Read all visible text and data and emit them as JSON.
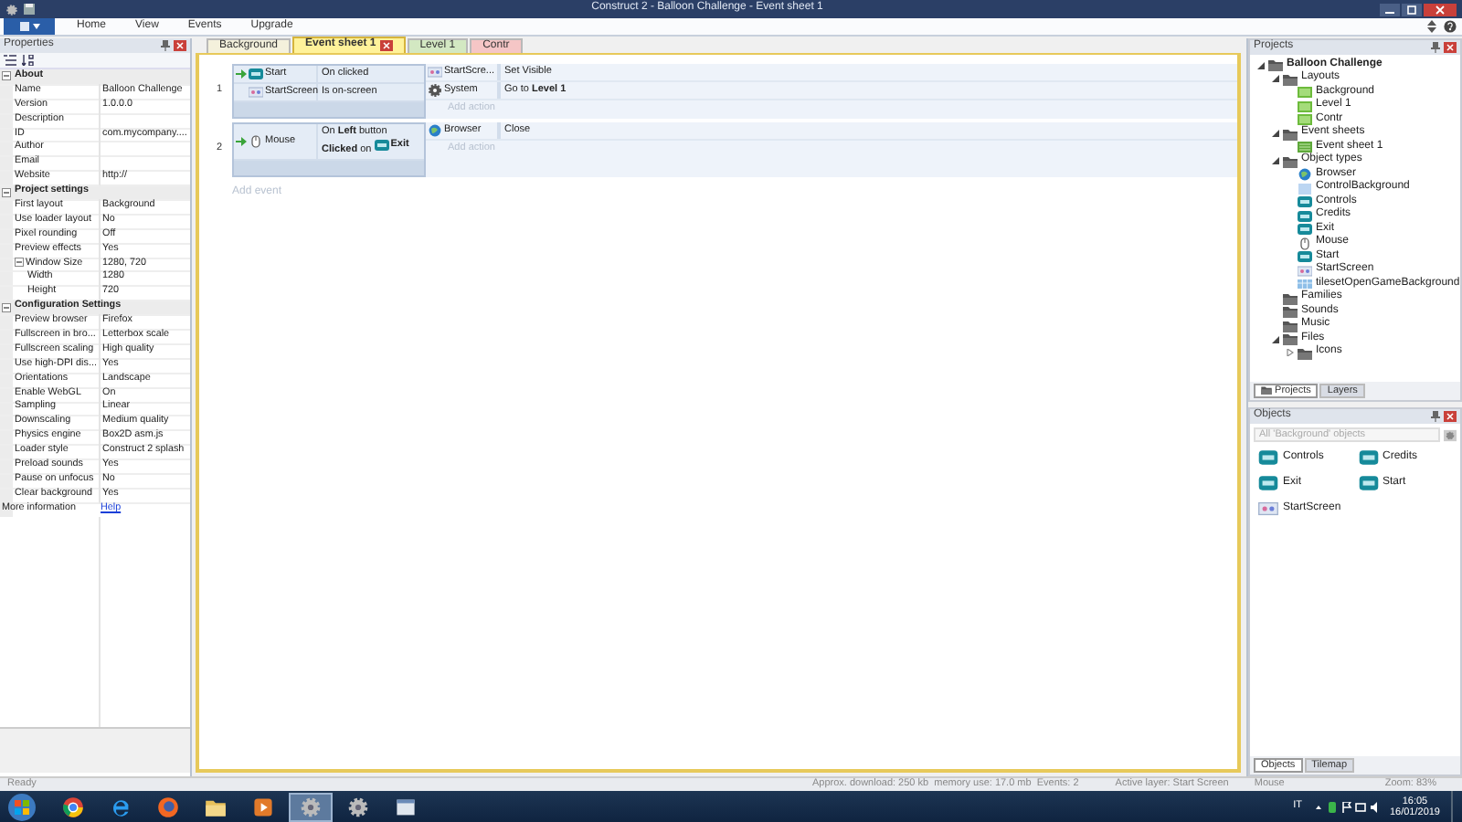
{
  "window": {
    "title": "Construct 2 - Balloon Challenge - Event sheet 1"
  },
  "ribbon": {
    "menu": [
      "Home",
      "View",
      "Events",
      "Upgrade"
    ]
  },
  "properties": {
    "title": "Properties",
    "groups": [
      {
        "title": "About",
        "expanded": true,
        "rows": [
          {
            "label": "Name",
            "value": "Balloon Challenge"
          },
          {
            "label": "Version",
            "value": "1.0.0.0"
          },
          {
            "label": "Description",
            "value": ""
          },
          {
            "label": "ID",
            "value": "com.mycompany...."
          },
          {
            "label": "Author",
            "value": ""
          },
          {
            "label": "Email",
            "value": ""
          },
          {
            "label": "Website",
            "value": "http://"
          }
        ]
      },
      {
        "title": "Project settings",
        "expanded": true,
        "rows": [
          {
            "label": "First layout",
            "value": "Background"
          },
          {
            "label": "Use loader layout",
            "value": "No"
          },
          {
            "label": "Pixel rounding",
            "value": "Off"
          },
          {
            "label": "Preview effects",
            "value": "Yes"
          },
          {
            "label": "Window Size",
            "value": "1280, 720",
            "expanded": true,
            "children": [
              {
                "label": "Width",
                "value": "1280"
              },
              {
                "label": "Height",
                "value": "720"
              }
            ]
          }
        ]
      },
      {
        "title": "Configuration Settings",
        "expanded": true,
        "rows": [
          {
            "label": "Preview browser",
            "value": "Firefox"
          },
          {
            "label": "Fullscreen in bro...",
            "value": "Letterbox scale"
          },
          {
            "label": "Fullscreen scaling",
            "value": "High quality"
          },
          {
            "label": "Use high-DPI dis...",
            "value": "Yes"
          },
          {
            "label": "Orientations",
            "value": "Landscape"
          },
          {
            "label": "Enable WebGL",
            "value": "On"
          },
          {
            "label": "Sampling",
            "value": "Linear"
          },
          {
            "label": "Downscaling",
            "value": "Medium quality"
          },
          {
            "label": "Physics engine",
            "value": "Box2D asm.js"
          },
          {
            "label": "Loader style",
            "value": "Construct 2 splash"
          },
          {
            "label": "Preload sounds",
            "value": "Yes"
          },
          {
            "label": "Pause on unfocus",
            "value": "No"
          },
          {
            "label": "Clear background",
            "value": "Yes"
          }
        ]
      }
    ],
    "footer": {
      "label": "More information",
      "link": "Help"
    }
  },
  "event_sheet": {
    "tabs": [
      {
        "label": "Background",
        "selected": false,
        "color": "#f4f1dc"
      },
      {
        "label": "Event sheet 1",
        "selected": true,
        "color": "#fff29a"
      },
      {
        "label": "Level 1",
        "selected": false,
        "color": "#d3e8c2"
      },
      {
        "label": "Contr",
        "selected": false,
        "color": "#f5c6c6"
      }
    ],
    "events": [
      {
        "number": "1",
        "conditions": [
          {
            "kind": "button",
            "object": "Start",
            "trigger": true,
            "text": "On clicked"
          },
          {
            "kind": "sprite",
            "object": "StartScreen",
            "trigger": false,
            "text": "Is on-screen"
          }
        ],
        "actions": [
          {
            "kind": "sprite",
            "object": "StartScre...",
            "text": "Set Visible"
          },
          {
            "kind": "system",
            "object": "System",
            "text": "Go to **Level 1**"
          }
        ],
        "add_action": "Add action"
      },
      {
        "number": "2",
        "conditions": [
          {
            "kind": "mouse",
            "object": "Mouse",
            "trigger": true,
            "text": "On **Left** button **Clicked** on",
            "target": {
              "kind": "button",
              "label": "Exit"
            }
          }
        ],
        "actions": [
          {
            "kind": "browser",
            "object": "Browser",
            "text": "Close"
          }
        ],
        "add_action": "Add action"
      }
    ],
    "add_event": "Add event"
  },
  "projects": {
    "title": "Projects",
    "tree": [
      {
        "label": "Balloon Challenge",
        "kind": "folder",
        "expanded": true,
        "children": [
          {
            "label": "Layouts",
            "kind": "folder",
            "expanded": true,
            "children": [
              {
                "label": "Background",
                "kind": "layout"
              },
              {
                "label": "Level 1",
                "kind": "layout"
              },
              {
                "label": "Contr",
                "kind": "layout"
              }
            ]
          },
          {
            "label": "Event sheets",
            "kind": "folder",
            "expanded": true,
            "children": [
              {
                "label": "Event sheet 1",
                "kind": "eventsheet"
              }
            ]
          },
          {
            "label": "Object types",
            "kind": "folder",
            "expanded": true,
            "children": [
              {
                "label": "Browser",
                "kind": "browser"
              },
              {
                "label": "ControlBackground",
                "kind": "plain"
              },
              {
                "label": "Controls",
                "kind": "button"
              },
              {
                "label": "Credits",
                "kind": "button"
              },
              {
                "label": "Exit",
                "kind": "button"
              },
              {
                "label": "Mouse",
                "kind": "mouse"
              },
              {
                "label": "Start",
                "kind": "button"
              },
              {
                "label": "StartScreen",
                "kind": "sprite"
              },
              {
                "label": "tilesetOpenGameBackground",
                "kind": "tiled"
              }
            ]
          },
          {
            "label": "Families",
            "kind": "folder"
          },
          {
            "label": "Sounds",
            "kind": "folder"
          },
          {
            "label": "Music",
            "kind": "folder"
          },
          {
            "label": "Files",
            "kind": "folder",
            "expanded": true,
            "children": [
              {
                "label": "Icons",
                "kind": "folder",
                "expanded": false
              }
            ]
          }
        ]
      }
    ],
    "tabs": [
      {
        "label": "Projects",
        "selected": true
      },
      {
        "label": "Layers",
        "selected": false
      }
    ]
  },
  "objects": {
    "title": "Objects",
    "placeholder": "All 'Background' objects",
    "items": [
      {
        "kind": "button",
        "label": "Controls"
      },
      {
        "kind": "button",
        "label": "Credits"
      },
      {
        "kind": "button",
        "label": "Exit"
      },
      {
        "kind": "button",
        "label": "Start"
      },
      {
        "kind": "sprite",
        "label": "StartScreen"
      }
    ],
    "tabs": [
      {
        "label": "Objects",
        "selected": true
      },
      {
        "label": "Tilemap",
        "selected": false
      }
    ]
  },
  "status_bar": {
    "state": "Ready",
    "download": "Approx. download: 250 kb  memory use: 17.0 mb  Events: 2",
    "layer": "Active layer: Start Screen",
    "object": "Mouse",
    "zoom": "Zoom: 83%"
  },
  "taskbar": {
    "apps": [
      {
        "kind": "chrome",
        "selected": false
      },
      {
        "kind": "ie",
        "selected": false
      },
      {
        "kind": "firefox",
        "selected": false
      },
      {
        "kind": "explorer",
        "selected": false
      },
      {
        "kind": "media",
        "selected": false
      },
      {
        "kind": "construct",
        "selected": true
      },
      {
        "kind": "construct",
        "selected": false
      },
      {
        "kind": "generic",
        "selected": false
      }
    ],
    "language": "IT",
    "time": "16:05",
    "date": "16/01/2019"
  }
}
